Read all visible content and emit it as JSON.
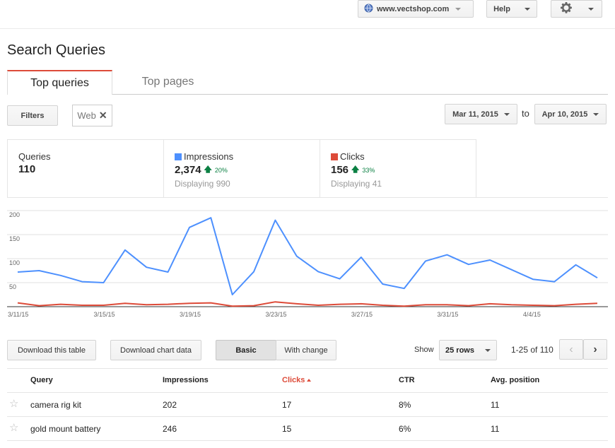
{
  "header": {
    "site_label": "www.vectshop.com",
    "help_label": "Help",
    "gear_icon": "gear-icon",
    "globe_icon": "globe-icon"
  },
  "page": {
    "title": "Search Queries"
  },
  "tabs": [
    {
      "label": "Top queries",
      "active": true
    },
    {
      "label": "Top pages",
      "active": false
    }
  ],
  "filters": {
    "filters_label": "Filters",
    "chip_label": "Web",
    "date_from": "Mar 11, 2015",
    "date_to_sep": "to",
    "date_to": "Apr 10, 2015"
  },
  "summary": {
    "queries": {
      "label": "Queries",
      "value": "110"
    },
    "impressions": {
      "label": "Impressions",
      "value": "2,374",
      "change": "20%",
      "displaying": "Displaying 990",
      "color": "#4d90fe"
    },
    "clicks": {
      "label": "Clicks",
      "value": "156",
      "change": "33%",
      "displaying": "Displaying 41",
      "color": "#dd4b39"
    }
  },
  "chart_data": {
    "type": "line",
    "yticks": [
      "200",
      "150",
      "100",
      "50"
    ],
    "ylim": [
      0,
      200
    ],
    "xticks": [
      "3/11/15",
      "3/15/15",
      "3/19/15",
      "3/23/15",
      "3/27/15",
      "3/31/15",
      "4/4/15"
    ],
    "series": [
      {
        "name": "Impressions",
        "color": "#4d90fe",
        "values": [
          72,
          75,
          65,
          52,
          50,
          118,
          82,
          72,
          165,
          185,
          25,
          73,
          180,
          105,
          73,
          58,
          103,
          47,
          38,
          95,
          108,
          88,
          97,
          77,
          57,
          52,
          87,
          60
        ]
      },
      {
        "name": "Clicks",
        "color": "#dd4b39",
        "values": [
          8,
          2,
          5,
          3,
          3,
          7,
          4,
          5,
          7,
          8,
          1,
          2,
          10,
          6,
          3,
          5,
          6,
          3,
          1,
          4,
          4,
          2,
          6,
          4,
          3,
          2,
          5,
          7
        ]
      }
    ]
  },
  "actions": {
    "download_table": "Download this table",
    "download_chart": "Download chart data",
    "basic": "Basic",
    "with_change": "With change",
    "show_label": "Show",
    "rows_select": "25 rows",
    "pagination": "1-25 of 110"
  },
  "table": {
    "columns": [
      "Query",
      "Impressions",
      "Clicks",
      "CTR",
      "Avg. position"
    ],
    "sorted_column": "Clicks",
    "rows": [
      {
        "query": "camera rig kit",
        "impressions": "202",
        "clicks": "17",
        "ctr": "8%",
        "position": "11"
      },
      {
        "query": "gold mount battery",
        "impressions": "246",
        "clicks": "15",
        "ctr": "6%",
        "position": "11"
      }
    ]
  }
}
